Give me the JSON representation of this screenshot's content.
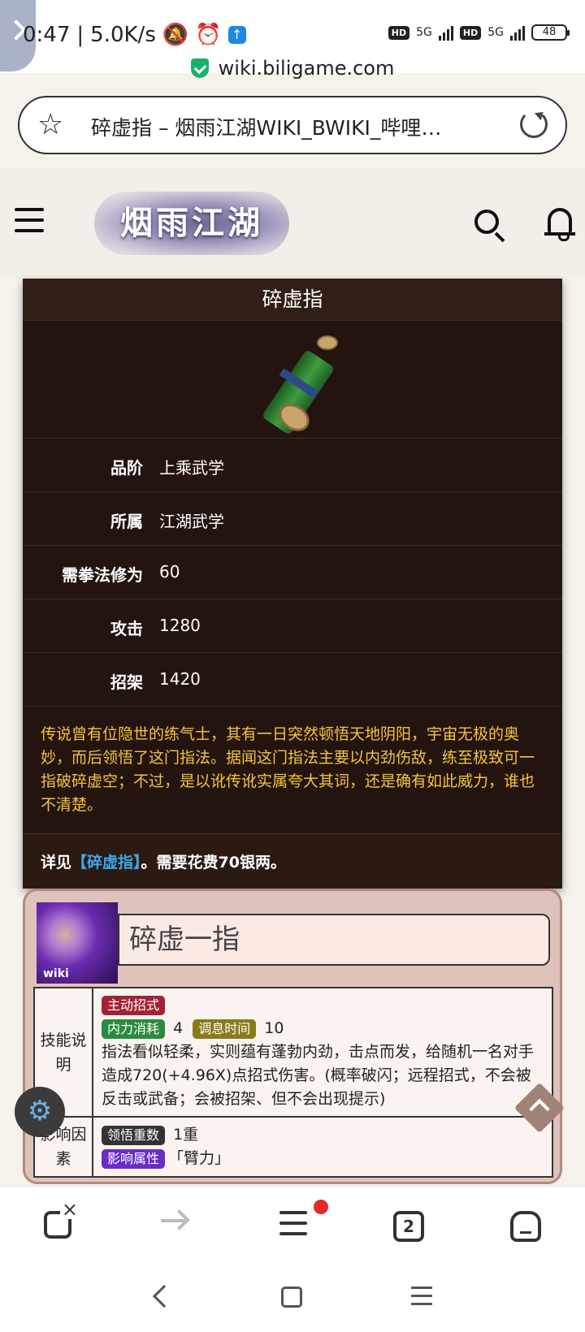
{
  "status": {
    "time": "0:47",
    "speed": "5.0K/s",
    "battery": "48",
    "net1": "5G",
    "net2": "5G",
    "hd": "HD"
  },
  "browser": {
    "domain": "wiki.biligame.com",
    "tab_title": "碎虚指 – 烟雨江湖WIKI_BWIKI_哔哩…",
    "tab_count": "2"
  },
  "site": {
    "logo_text": "烟雨江湖"
  },
  "infobox": {
    "title": "碎虚指",
    "rows": [
      {
        "key": "品阶",
        "value": "上乘武学"
      },
      {
        "key": "所属",
        "value": "江湖武学"
      },
      {
        "key": "需拳法修为",
        "value": "60"
      },
      {
        "key": "攻击",
        "value": "1280"
      },
      {
        "key": "招架",
        "value": "1420"
      }
    ],
    "description": "传说曾有位隐世的练气士，其有一日突然顿悟天地阴阳，宇宙无极的奥妙，而后领悟了这门指法。据闻这门指法主要以内劲伤敌，练至极致可一指破碎虚空；不过，是以讹传讹实属夸大其词，还是确有如此威力，谁也不清楚。",
    "more_prefix": "详见",
    "more_link": "【碎虚指】",
    "more_suffix": "。需要花费70银两。"
  },
  "skill": {
    "name": "碎虚一指",
    "thumb_watermark": "wiki",
    "label_desc": "技能说明",
    "tag_active": "主动招式",
    "tag_cost": "内力消耗",
    "cost_value": "4",
    "tag_cooldown": "调息时间",
    "cooldown_value": "10",
    "desc": "指法看似轻柔，实则蕴有蓬勃内劲，击点而发，给随机一名对手造成720(+4.96X)点招式伤害。(概率破闪；远程招式，不会被反击或武备；会被招架、但不会出现提示)",
    "label_factor": "影响因素",
    "tag_layers": "领悟重数",
    "layers_value": "1重",
    "tag_attr": "影响属性",
    "attr_value": "「臂力」"
  }
}
